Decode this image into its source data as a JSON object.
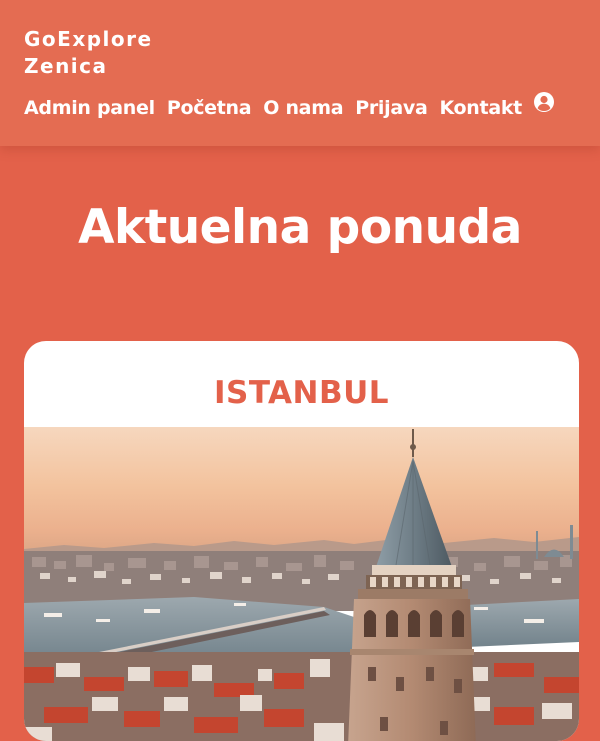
{
  "brand": {
    "line1": "GoExplore",
    "line2": "Zenica"
  },
  "nav": {
    "items": [
      {
        "label": "Admin panel"
      },
      {
        "label": "Početna"
      },
      {
        "label": "O nama"
      },
      {
        "label": "Prijava"
      },
      {
        "label": "Kontakt"
      }
    ],
    "user_icon": "user-circle-icon"
  },
  "hero": {
    "title": "Aktuelna ponuda"
  },
  "offer": {
    "destination": "ISTANBUL",
    "image_subject": "galata-tower-istanbul-sunset"
  },
  "colors": {
    "accent": "#E3614A",
    "header": "#E46C52",
    "text_light": "#ffffff"
  }
}
